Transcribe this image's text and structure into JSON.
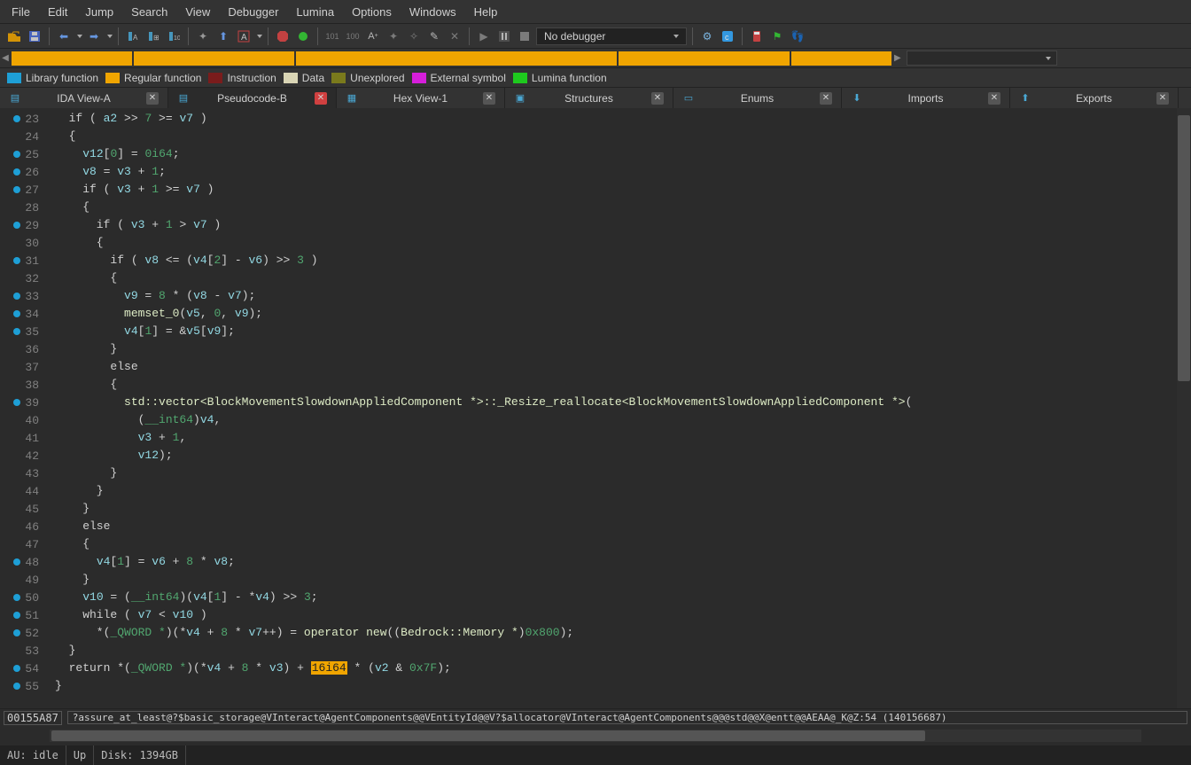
{
  "menu": [
    "File",
    "Edit",
    "Jump",
    "Search",
    "View",
    "Debugger",
    "Lumina",
    "Options",
    "Windows",
    "Help"
  ],
  "no_debugger": "No debugger",
  "legend": [
    {
      "label": "Library function",
      "color": "#1e9fd6"
    },
    {
      "label": "Regular function",
      "color": "#f0a500"
    },
    {
      "label": "Instruction",
      "color": "#7a1c1c"
    },
    {
      "label": "Data",
      "color": "#d9d5b5"
    },
    {
      "label": "Unexplored",
      "color": "#7a7a1c"
    },
    {
      "label": "External symbol",
      "color": "#d61edb"
    },
    {
      "label": "Lumina function",
      "color": "#1ec91e"
    }
  ],
  "tabs": [
    {
      "label": "IDA View-A",
      "close": "grey"
    },
    {
      "label": "Pseudocode-B",
      "close": "red",
      "active": true
    },
    {
      "label": "Hex View-1",
      "close": "grey"
    },
    {
      "label": "Structures",
      "close": "grey"
    },
    {
      "label": "Enums",
      "close": "grey"
    },
    {
      "label": "Imports",
      "close": "grey"
    },
    {
      "label": "Exports",
      "close": "grey"
    }
  ],
  "code": [
    {
      "n": 23,
      "bp": true,
      "tokens": [
        [
          "op",
          "  if ( "
        ],
        [
          "var",
          "a2"
        ],
        [
          "op",
          " >> "
        ],
        [
          "num",
          "7"
        ],
        [
          "op",
          " >= "
        ],
        [
          "var",
          "v7"
        ],
        [
          "op",
          " )"
        ]
      ]
    },
    {
      "n": 24,
      "tokens": [
        [
          "op",
          "  {"
        ]
      ]
    },
    {
      "n": 25,
      "bp": true,
      "tokens": [
        [
          "op",
          "    "
        ],
        [
          "var",
          "v12"
        ],
        [
          "op",
          "["
        ],
        [
          "num",
          "0"
        ],
        [
          "op",
          "] = "
        ],
        [
          "num",
          "0i64"
        ],
        [
          "op",
          ";"
        ]
      ]
    },
    {
      "n": 26,
      "bp": true,
      "tokens": [
        [
          "op",
          "    "
        ],
        [
          "var",
          "v8"
        ],
        [
          "op",
          " = "
        ],
        [
          "var",
          "v3"
        ],
        [
          "op",
          " + "
        ],
        [
          "num",
          "1"
        ],
        [
          "op",
          ";"
        ]
      ]
    },
    {
      "n": 27,
      "bp": true,
      "tokens": [
        [
          "op",
          "    if ( "
        ],
        [
          "var",
          "v3"
        ],
        [
          "op",
          " + "
        ],
        [
          "num",
          "1"
        ],
        [
          "op",
          " >= "
        ],
        [
          "var",
          "v7"
        ],
        [
          "op",
          " )"
        ]
      ]
    },
    {
      "n": 28,
      "tokens": [
        [
          "op",
          "    {"
        ]
      ]
    },
    {
      "n": 29,
      "bp": true,
      "tokens": [
        [
          "op",
          "      if ( "
        ],
        [
          "var",
          "v3"
        ],
        [
          "op",
          " + "
        ],
        [
          "num",
          "1"
        ],
        [
          "op",
          " > "
        ],
        [
          "var",
          "v7"
        ],
        [
          "op",
          " )"
        ]
      ]
    },
    {
      "n": 30,
      "tokens": [
        [
          "op",
          "      {"
        ]
      ]
    },
    {
      "n": 31,
      "bp": true,
      "tokens": [
        [
          "op",
          "        if ( "
        ],
        [
          "var",
          "v8"
        ],
        [
          "op",
          " <= ("
        ],
        [
          "var",
          "v4"
        ],
        [
          "op",
          "["
        ],
        [
          "num",
          "2"
        ],
        [
          "op",
          "] - "
        ],
        [
          "var",
          "v6"
        ],
        [
          "op",
          ") >> "
        ],
        [
          "num",
          "3"
        ],
        [
          "op",
          " )"
        ]
      ]
    },
    {
      "n": 32,
      "tokens": [
        [
          "op",
          "        {"
        ]
      ]
    },
    {
      "n": 33,
      "bp": true,
      "tokens": [
        [
          "op",
          "          "
        ],
        [
          "var",
          "v9"
        ],
        [
          "op",
          " = "
        ],
        [
          "num",
          "8"
        ],
        [
          "op",
          " * ("
        ],
        [
          "var",
          "v8"
        ],
        [
          "op",
          " - "
        ],
        [
          "var",
          "v7"
        ],
        [
          "op",
          ");"
        ]
      ]
    },
    {
      "n": 34,
      "bp": true,
      "tokens": [
        [
          "op",
          "          "
        ],
        [
          "fn",
          "memset_0"
        ],
        [
          "op",
          "("
        ],
        [
          "var",
          "v5"
        ],
        [
          "op",
          ", "
        ],
        [
          "num",
          "0"
        ],
        [
          "op",
          ", "
        ],
        [
          "var",
          "v9"
        ],
        [
          "op",
          ");"
        ]
      ]
    },
    {
      "n": 35,
      "bp": true,
      "tokens": [
        [
          "op",
          "          "
        ],
        [
          "var",
          "v4"
        ],
        [
          "op",
          "["
        ],
        [
          "num",
          "1"
        ],
        [
          "op",
          "] = &"
        ],
        [
          "var",
          "v5"
        ],
        [
          "op",
          "["
        ],
        [
          "var",
          "v9"
        ],
        [
          "op",
          "];"
        ]
      ]
    },
    {
      "n": 36,
      "tokens": [
        [
          "op",
          "        }"
        ]
      ]
    },
    {
      "n": 37,
      "tokens": [
        [
          "op",
          "        else"
        ]
      ]
    },
    {
      "n": 38,
      "tokens": [
        [
          "op",
          "        {"
        ]
      ]
    },
    {
      "n": 39,
      "bp": true,
      "tokens": [
        [
          "op",
          "          "
        ],
        [
          "fn",
          "std::vector<BlockMovementSlowdownAppliedComponent *>::_Resize_reallocate<BlockMovementSlowdownAppliedComponent *>"
        ],
        [
          "op",
          "("
        ]
      ]
    },
    {
      "n": 40,
      "tokens": [
        [
          "op",
          "            ("
        ],
        [
          "typ",
          "__int64"
        ],
        [
          "op",
          ")"
        ],
        [
          "var",
          "v4"
        ],
        [
          "op",
          ","
        ]
      ]
    },
    {
      "n": 41,
      "tokens": [
        [
          "op",
          "            "
        ],
        [
          "var",
          "v3"
        ],
        [
          "op",
          " + "
        ],
        [
          "num",
          "1"
        ],
        [
          "op",
          ","
        ]
      ]
    },
    {
      "n": 42,
      "tokens": [
        [
          "op",
          "            "
        ],
        [
          "var",
          "v12"
        ],
        [
          "op",
          ");"
        ]
      ]
    },
    {
      "n": 43,
      "tokens": [
        [
          "op",
          "        }"
        ]
      ]
    },
    {
      "n": 44,
      "tokens": [
        [
          "op",
          "      }"
        ]
      ]
    },
    {
      "n": 45,
      "tokens": [
        [
          "op",
          "    }"
        ]
      ]
    },
    {
      "n": 46,
      "tokens": [
        [
          "op",
          "    else"
        ]
      ]
    },
    {
      "n": 47,
      "tokens": [
        [
          "op",
          "    {"
        ]
      ]
    },
    {
      "n": 48,
      "bp": true,
      "tokens": [
        [
          "op",
          "      "
        ],
        [
          "var",
          "v4"
        ],
        [
          "op",
          "["
        ],
        [
          "num",
          "1"
        ],
        [
          "op",
          "] = "
        ],
        [
          "var",
          "v6"
        ],
        [
          "op",
          " + "
        ],
        [
          "num",
          "8"
        ],
        [
          "op",
          " * "
        ],
        [
          "var",
          "v8"
        ],
        [
          "op",
          ";"
        ]
      ]
    },
    {
      "n": 49,
      "tokens": [
        [
          "op",
          "    }"
        ]
      ]
    },
    {
      "n": 50,
      "bp": true,
      "tokens": [
        [
          "op",
          "    "
        ],
        [
          "var",
          "v10"
        ],
        [
          "op",
          " = ("
        ],
        [
          "typ",
          "__int64"
        ],
        [
          "op",
          ")("
        ],
        [
          "var",
          "v4"
        ],
        [
          "op",
          "["
        ],
        [
          "num",
          "1"
        ],
        [
          "op",
          "] - *"
        ],
        [
          "var",
          "v4"
        ],
        [
          "op",
          ") >> "
        ],
        [
          "num",
          "3"
        ],
        [
          "op",
          ";"
        ]
      ]
    },
    {
      "n": 51,
      "bp": true,
      "tokens": [
        [
          "op",
          "    while ( "
        ],
        [
          "var",
          "v7"
        ],
        [
          "op",
          " < "
        ],
        [
          "var",
          "v10"
        ],
        [
          "op",
          " )"
        ]
      ]
    },
    {
      "n": 52,
      "bp": true,
      "tokens": [
        [
          "op",
          "      *("
        ],
        [
          "typ",
          "_QWORD *"
        ],
        [
          "op",
          ")(*"
        ],
        [
          "var",
          "v4"
        ],
        [
          "op",
          " + "
        ],
        [
          "num",
          "8"
        ],
        [
          "op",
          " * "
        ],
        [
          "var",
          "v7"
        ],
        [
          "op",
          "++) = "
        ],
        [
          "fn",
          "operator new"
        ],
        [
          "op",
          "(("
        ],
        [
          "fn",
          "Bedrock::Memory *"
        ],
        [
          "op",
          ")"
        ],
        [
          "num",
          "0x800"
        ],
        [
          "op",
          ");"
        ]
      ]
    },
    {
      "n": 53,
      "tokens": [
        [
          "op",
          "  }"
        ]
      ]
    },
    {
      "n": 54,
      "bp": true,
      "tokens": [
        [
          "op",
          "  return *("
        ],
        [
          "typ",
          "_QWORD *"
        ],
        [
          "op",
          ")(*"
        ],
        [
          "var",
          "v4"
        ],
        [
          "op",
          " + "
        ],
        [
          "num",
          "8"
        ],
        [
          "op",
          " * "
        ],
        [
          "var",
          "v3"
        ],
        [
          "op",
          ") + "
        ],
        [
          "hl",
          "16i64"
        ],
        [
          "op",
          " * ("
        ],
        [
          "var",
          "v2"
        ],
        [
          "op",
          " & "
        ],
        [
          "num",
          "0x7F"
        ],
        [
          "op",
          ");"
        ]
      ]
    },
    {
      "n": 55,
      "bp": true,
      "tokens": [
        [
          "op",
          "}"
        ]
      ]
    }
  ],
  "info": {
    "addr": "00155A87",
    "desc": "?assure_at_least@?$basic_storage@VInteract@AgentComponents@@VEntityId@@V?$allocator@VInteract@AgentComponents@@@std@@X@entt@@AEAA@_K@Z:54 (140156687)"
  },
  "status": {
    "au": "AU:  idle",
    "up": "Up",
    "disk": "Disk: 1394GB"
  }
}
